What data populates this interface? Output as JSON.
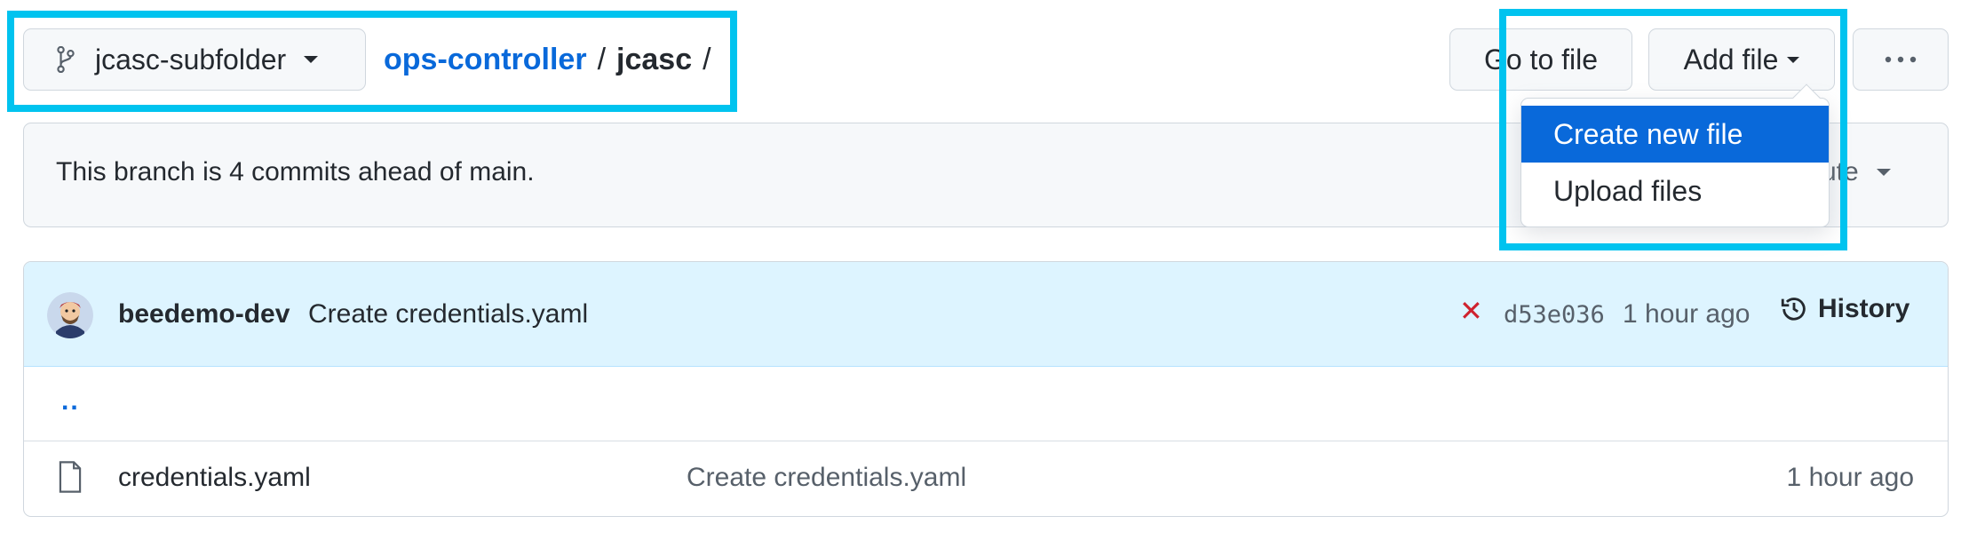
{
  "branch": {
    "name": "jcasc-subfolder",
    "icon": "git-branch-icon"
  },
  "breadcrumb": {
    "repo": "ops-controller",
    "sep1": "/",
    "folder": "jcasc",
    "sep2": "/"
  },
  "actions": {
    "go_to_file": "Go to file",
    "add_file": "Add file",
    "more": "···"
  },
  "dropdown": {
    "items": [
      {
        "label": "Create new file",
        "active": true
      },
      {
        "label": "Upload files",
        "active": false
      }
    ]
  },
  "branch_status": {
    "text": "This branch is 4 commits ahead of main.",
    "contribute_partial": "ute"
  },
  "latest_commit": {
    "author": "beedemo-dev",
    "message": "Create credentials.yaml",
    "status_icon": "x-icon",
    "sha": "d53e036",
    "time": "1 hour ago",
    "history_label": "History"
  },
  "files": {
    "parent": "..",
    "rows": [
      {
        "name": "credentials.yaml",
        "message": "Create credentials.yaml",
        "time": "1 hour ago",
        "icon": "file-icon"
      }
    ]
  },
  "colors": {
    "highlight": "#00c3ef",
    "link": "#0969da",
    "active_item": "#0969da",
    "error": "#cf222e"
  }
}
